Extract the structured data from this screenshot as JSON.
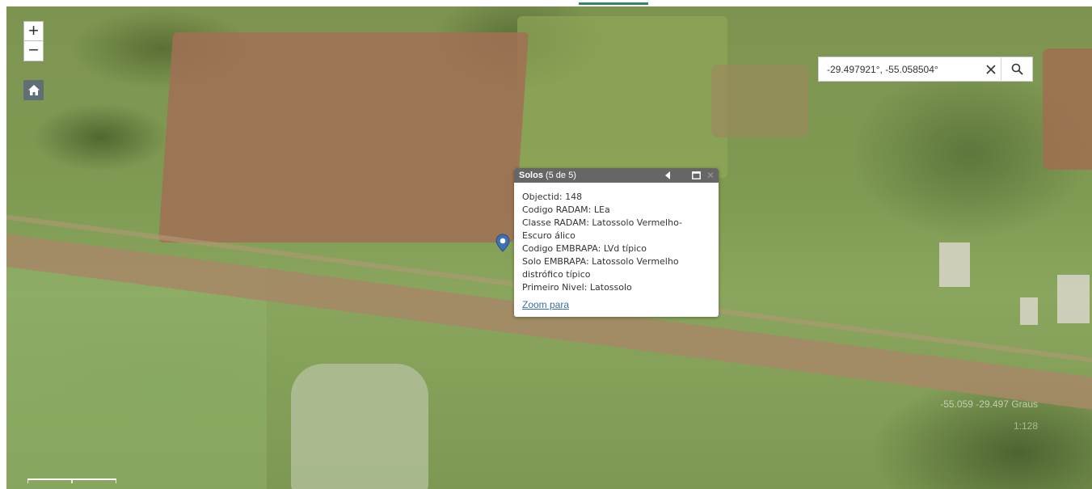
{
  "map": {
    "zoom_in_label": "+",
    "zoom_out_label": "−",
    "home_icon": "home-icon"
  },
  "search": {
    "value": "-29.497921°, -55.058504°",
    "clear_icon": "close-icon",
    "search_icon": "search-icon"
  },
  "popup": {
    "layer": "Solos",
    "count": "(5 de 5)",
    "fields": [
      "Objectid: 148",
      "Codigo RADAM: LEa",
      "Classe RADAM: Latossolo Vermelho-",
      "Escuro álico",
      "Codigo EMBRAPA: LVd típico",
      "Solo EMBRAPA: Latossolo Vermelho",
      "distrófico típico",
      "Primeiro Nivel: Latossolo"
    ],
    "zoom_link": "Zoom para"
  },
  "status": {
    "coordinates": "-55.059 -29.497 Graus",
    "scale": "1:128"
  },
  "colors": {
    "accent": "#2e8b57",
    "popup_header": "#666666",
    "link": "#3a6ea5",
    "pin": "#3f6fb5"
  }
}
